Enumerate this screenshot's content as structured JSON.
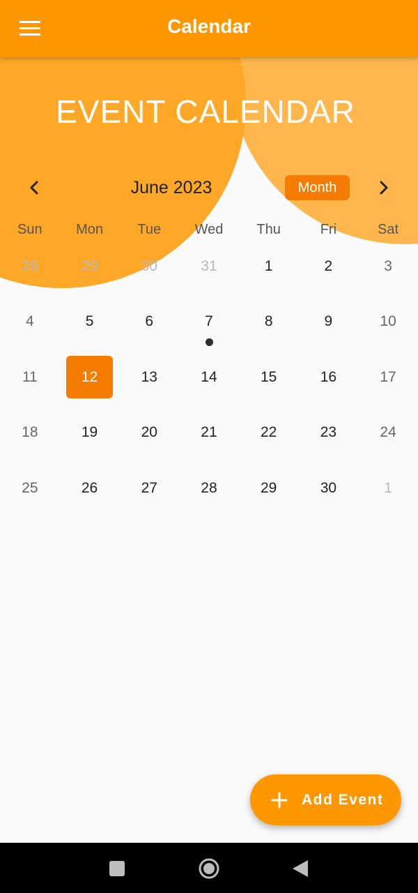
{
  "app_bar": {
    "title": "Calendar",
    "menu_icon": "hamburger-menu-icon"
  },
  "banner": {
    "title": "EVENT CALENDAR"
  },
  "calendar": {
    "month_label": "June 2023",
    "prev_icon": "chevron-left-icon",
    "next_icon": "chevron-right-icon",
    "format_button": "Month",
    "weekdays": [
      "Sun",
      "Mon",
      "Tue",
      "Wed",
      "Thu",
      "Fri",
      "Sat"
    ],
    "weeks": [
      [
        {
          "day": "28",
          "outside": true
        },
        {
          "day": "29",
          "outside": true
        },
        {
          "day": "30",
          "outside": true
        },
        {
          "day": "31",
          "outside": true
        },
        {
          "day": "1"
        },
        {
          "day": "2"
        },
        {
          "day": "3"
        }
      ],
      [
        {
          "day": "4"
        },
        {
          "day": "5"
        },
        {
          "day": "6"
        },
        {
          "day": "7",
          "event": true
        },
        {
          "day": "8"
        },
        {
          "day": "9"
        },
        {
          "day": "10"
        }
      ],
      [
        {
          "day": "11"
        },
        {
          "day": "12",
          "selected": true
        },
        {
          "day": "13"
        },
        {
          "day": "14"
        },
        {
          "day": "15"
        },
        {
          "day": "16"
        },
        {
          "day": "17"
        }
      ],
      [
        {
          "day": "18"
        },
        {
          "day": "19"
        },
        {
          "day": "20"
        },
        {
          "day": "21"
        },
        {
          "day": "22"
        },
        {
          "day": "23"
        },
        {
          "day": "24"
        }
      ],
      [
        {
          "day": "25"
        },
        {
          "day": "26"
        },
        {
          "day": "27"
        },
        {
          "day": "28"
        },
        {
          "day": "29"
        },
        {
          "day": "30"
        },
        {
          "day": "1",
          "outside": true
        }
      ]
    ]
  },
  "fab": {
    "label": "Add Event",
    "icon": "plus-icon"
  },
  "system_nav": {
    "recent_icon": "recent-apps-icon",
    "home_icon": "home-icon",
    "back_icon": "back-icon"
  },
  "colors": {
    "primary": "#ff9800",
    "selected": "#f57c00",
    "circle_light": "#ffb74d",
    "circle_dark": "#ffa726",
    "event_marker": "#263238"
  }
}
